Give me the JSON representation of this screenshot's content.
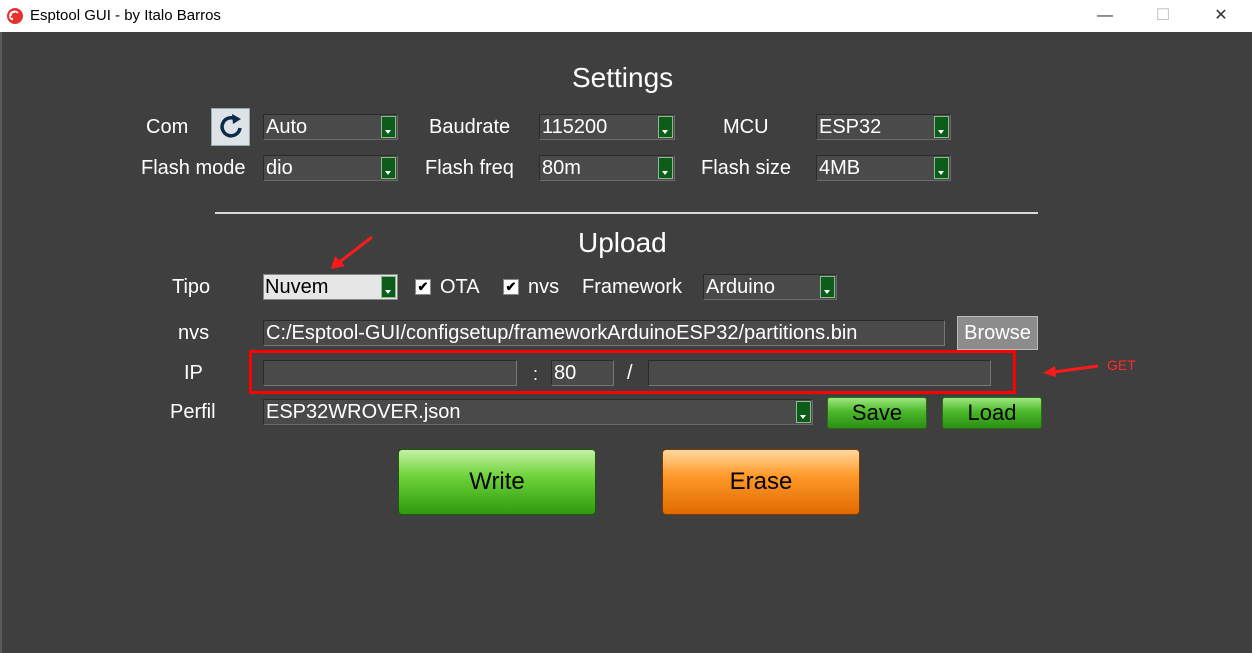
{
  "window": {
    "title": "Esptool GUI - by Italo Barros",
    "min_glyph": "—",
    "max_glyph": "☐",
    "close_glyph": "✕"
  },
  "settings": {
    "heading": "Settings",
    "com_label": "Com",
    "com_value": "Auto",
    "baudrate_label": "Baudrate",
    "baudrate_value": "115200",
    "mcu_label": "MCU",
    "mcu_value": "ESP32",
    "flash_mode_label": "Flash mode",
    "flash_mode_value": "dio",
    "flash_freq_label": "Flash freq",
    "flash_freq_value": "80m",
    "flash_size_label": "Flash size",
    "flash_size_value": "4MB"
  },
  "upload": {
    "heading": "Upload",
    "tipo_label": "Tipo",
    "tipo_value": "Nuvem",
    "ota_label": "OTA",
    "ota_checked": "✔",
    "nvs_check_label": "nvs",
    "nvs_checked": "✔",
    "framework_label": "Framework",
    "framework_value": "Arduino",
    "nvs_label": "nvs",
    "nvs_path": "C:/Esptool-GUI/configsetup/frameworkArduinoESP32/partitions.bin",
    "browse_label": "Browse",
    "ip_label": "IP",
    "ip_value": "",
    "colon": ":",
    "port_value": "80",
    "slash": "/",
    "path_value": "",
    "perfil_label": "Perfil",
    "perfil_value": "ESP32WROVER.json",
    "save_label": "Save",
    "load_label": "Load"
  },
  "actions": {
    "write_label": "Write",
    "erase_label": "Erase"
  },
  "annotations": {
    "get_label": "GET"
  },
  "colors": {
    "background": "#3f3f3f",
    "highlight": "#ff0000",
    "combo_arrow": "#0c5c1a"
  }
}
